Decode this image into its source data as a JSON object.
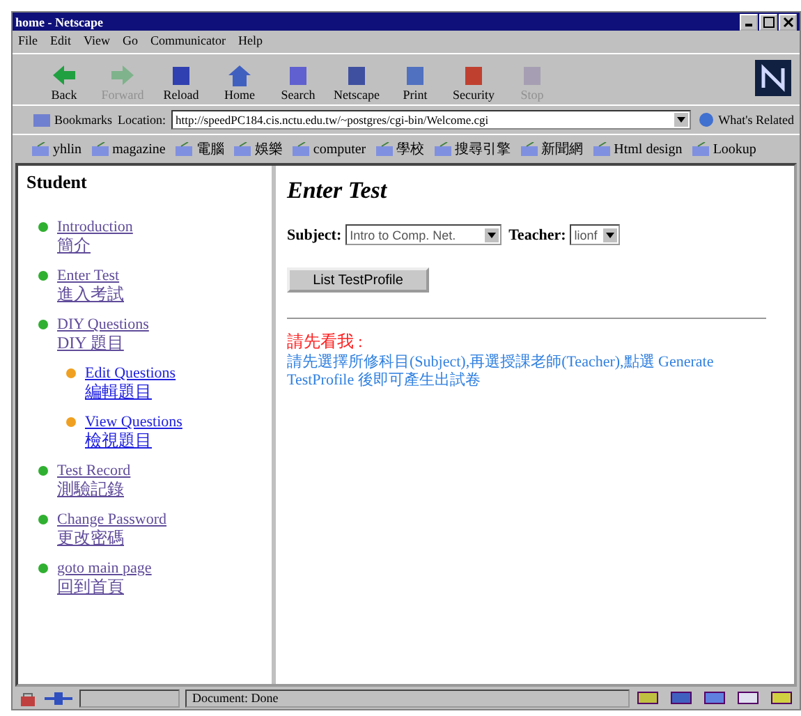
{
  "window": {
    "title": "home - Netscape"
  },
  "menu": [
    "File",
    "Edit",
    "View",
    "Go",
    "Communicator",
    "Help"
  ],
  "toolbar": [
    {
      "label": "Back",
      "disabled": false
    },
    {
      "label": "Forward",
      "disabled": true
    },
    {
      "label": "Reload",
      "disabled": false
    },
    {
      "label": "Home",
      "disabled": false
    },
    {
      "label": "Search",
      "disabled": false
    },
    {
      "label": "Netscape",
      "disabled": false
    },
    {
      "label": "Print",
      "disabled": false
    },
    {
      "label": "Security",
      "disabled": false
    },
    {
      "label": "Stop",
      "disabled": true
    }
  ],
  "location_bar": {
    "bookmarks": "Bookmarks",
    "location_label": "Location:",
    "url": "http://speedPC184.cis.nctu.edu.tw/~postgres/cgi-bin/Welcome.cgi",
    "whats_related": "What's Related"
  },
  "personal_toolbar": [
    "yhlin",
    "magazine",
    "電腦",
    "娛樂",
    "computer",
    "學校",
    "搜尋引擎",
    "新聞網",
    "Html design",
    "Lookup"
  ],
  "sidebar": {
    "title": "Student",
    "items": [
      {
        "label": "Introduction",
        "label_zh": "簡介"
      },
      {
        "label": "Enter Test",
        "label_zh": "進入考試"
      },
      {
        "label": "DIY Questions",
        "label_zh": "DIY 題目",
        "children": [
          {
            "label": "Edit  Questions",
            "label_zh": "編輯題目"
          },
          {
            "label": "View  Questions",
            "label_zh": "檢視題目"
          }
        ]
      },
      {
        "label": "Test Record",
        "label_zh": "測驗記錄"
      },
      {
        "label": "Change Password",
        "label_zh": "更改密碼"
      },
      {
        "label": "goto main page",
        "label_zh": "回到首頁"
      }
    ]
  },
  "main": {
    "heading": "Enter Test",
    "subject_label": "Subject:",
    "subject_value": "Intro to Comp. Net.",
    "teacher_label": "Teacher:",
    "teacher_value": "lionf",
    "button": "List TestProfile",
    "notice_title": "請先看我 :",
    "notice_text": "請先選擇所修科目(Subject),再選授課老師(Teacher),點選 Generate TestProfile 後即可產生出試卷"
  },
  "status_bar": {
    "text": "Document: Done"
  }
}
